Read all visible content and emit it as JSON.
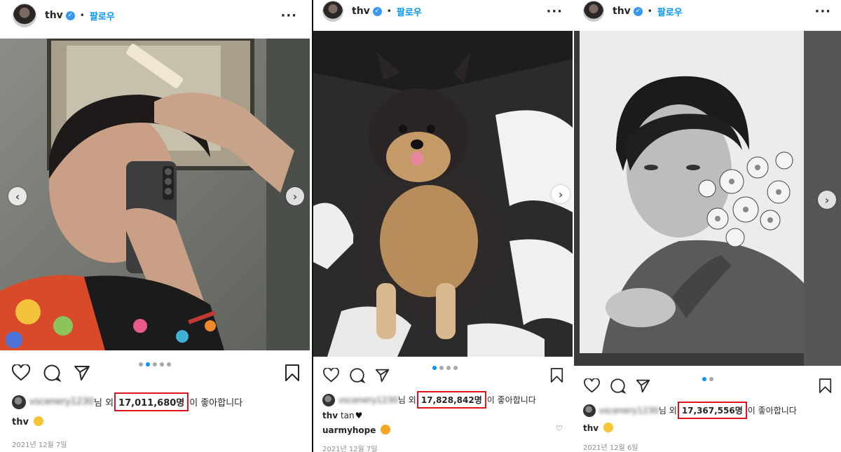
{
  "posts": [
    {
      "username": "thv",
      "verified_mark": "✓",
      "separator": "•",
      "follow_label": "팔로우",
      "more": "···",
      "liker": "vscenery1230",
      "likes_prefix": "님 외 ",
      "likes_count": "17,011,680명",
      "likes_suffix": "이 좋아합니다",
      "caption_user": "thv",
      "caption_text": "",
      "date": "2021년 12월 7일",
      "carousel_total": 5,
      "carousel_active": 1
    },
    {
      "username": "thv",
      "verified_mark": "✓",
      "separator": "•",
      "follow_label": "팔로우",
      "more": "···",
      "liker": "vscenery1230",
      "likes_prefix": "님 외 ",
      "likes_count": "17,828,842명",
      "likes_suffix": "이 좋아합니다",
      "caption_user": "thv",
      "caption_text": "tan",
      "comment_user": "uarmyhope",
      "date": "2021년 12월 7일",
      "carousel_total": 4,
      "carousel_active": 0
    },
    {
      "username": "thv",
      "verified_mark": "✓",
      "separator": "•",
      "follow_label": "팔로우",
      "more": "···",
      "liker": "vscenery1230",
      "likes_prefix": "님 외 ",
      "likes_count": "17,367,556명",
      "likes_suffix": "이 좋아합니다",
      "caption_user": "thv",
      "caption_text": "",
      "date": "2021년 12월 6일",
      "carousel_total": 2,
      "carousel_active": 0
    }
  ],
  "nav": {
    "prev": "‹",
    "next": "›"
  },
  "colors": {
    "accent": "#0095f6",
    "highlight_box": "#e0141e",
    "text": "#262626",
    "muted": "#8e8e8e"
  },
  "icons": [
    "heart-icon",
    "comment-icon",
    "share-icon",
    "bookmark-icon",
    "chevron-left-icon",
    "chevron-right-icon",
    "more-icon",
    "verified-icon"
  ]
}
